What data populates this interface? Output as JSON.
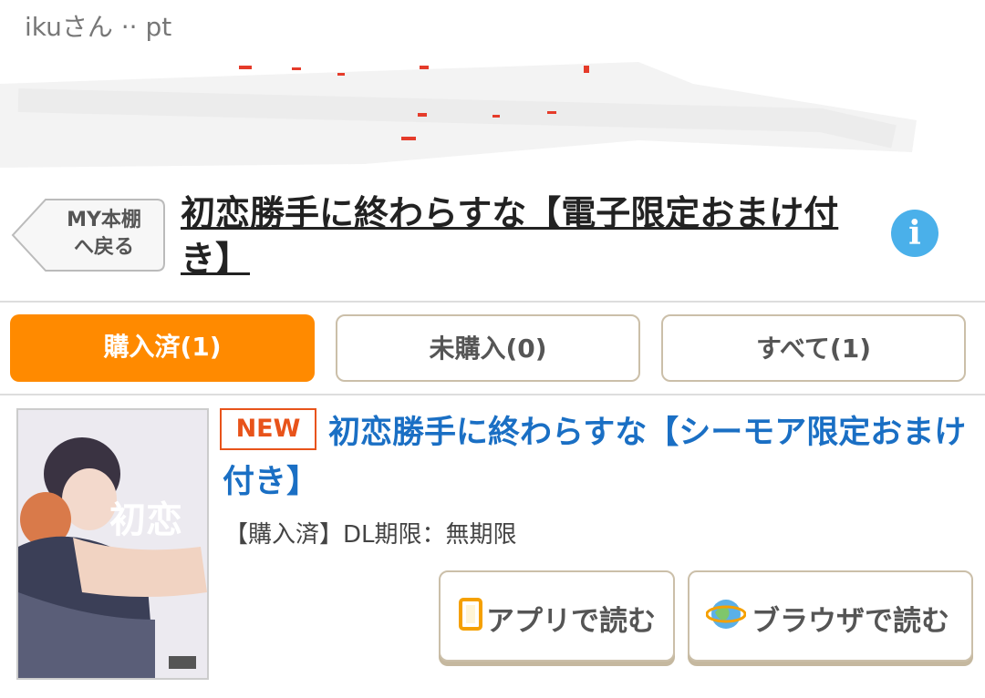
{
  "user": {
    "line": "ikuさん ·· pt"
  },
  "header": {
    "back_label": "MY本棚\nへ戻る",
    "title": "初恋勝手に終わらすな【電子限定おまけ付き】",
    "info_icon": "info-icon"
  },
  "tabs": [
    {
      "label": "購入済(1)",
      "active": true
    },
    {
      "label": "未購入(0)",
      "active": false
    },
    {
      "label": "すべて(1)",
      "active": false
    }
  ],
  "item": {
    "badge": "NEW",
    "title": "初恋勝手に終わらすな【シーモア限定おまけ付き】",
    "status": "【購入済】DL期限：無期限",
    "cover_text": "初恋",
    "buttons": {
      "app": {
        "label": "アプリで読む",
        "icon": "smartphone-icon"
      },
      "browser": {
        "label": "ブラウザで読む",
        "icon": "globe-icon"
      }
    }
  },
  "colors": {
    "accent": "#ff8a00",
    "link": "#1a6fc4",
    "new": "#e8531a",
    "info": "#4ab0ea"
  }
}
